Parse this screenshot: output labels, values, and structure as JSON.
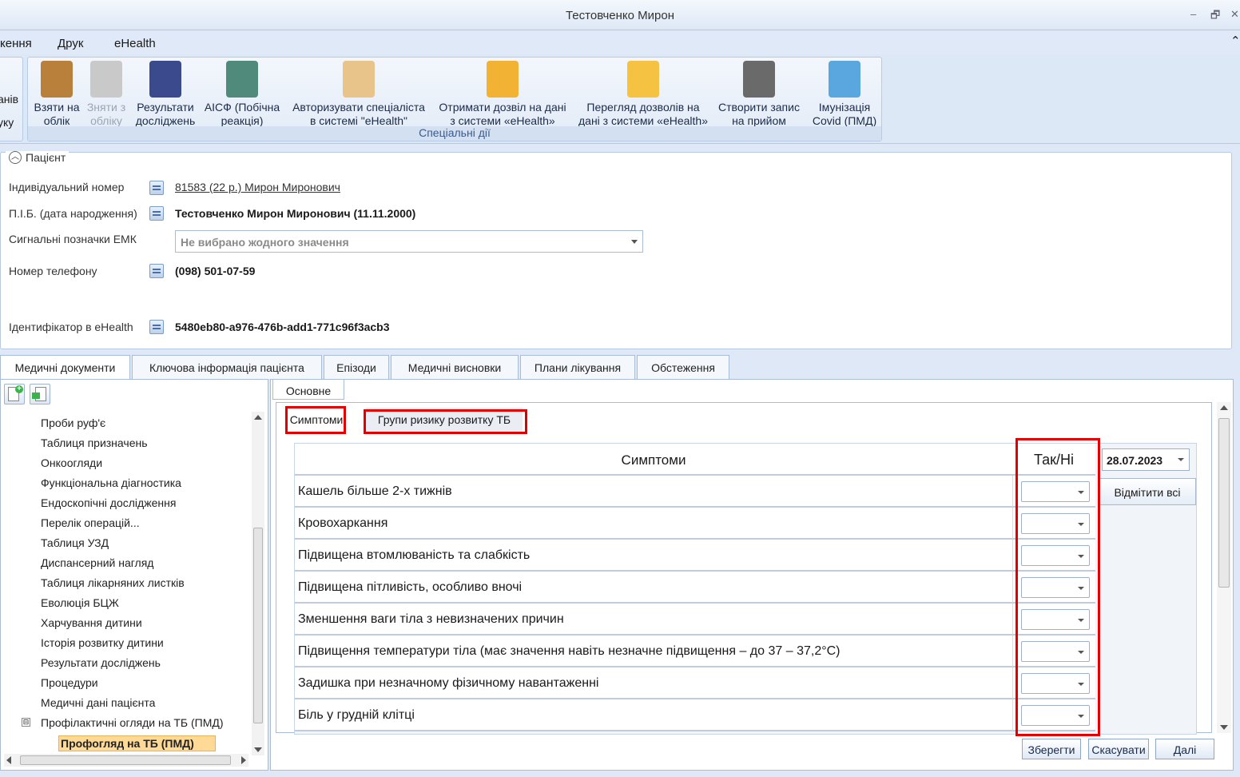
{
  "window": {
    "title": "Тестовченко Мирон",
    "min": "–",
    "restore": "🗗",
    "close": "✕"
  },
  "menu": {
    "items": [
      "кення",
      "Друк",
      "eHealth"
    ],
    "collapse": "⌃"
  },
  "ribbon": {
    "left_partial": [
      "анів",
      "уку"
    ],
    "group_caption": "Спеціальні дії",
    "buttons": [
      {
        "label1": "Взяти на",
        "label2": "облік",
        "icon": "book-add-icon",
        "color": "#b9803c",
        "disabled": false
      },
      {
        "label1": "Зняти з",
        "label2": "обліку",
        "icon": "book-remove-icon",
        "color": "#c9c9c9",
        "disabled": true
      },
      {
        "label1": "Результати",
        "label2": "досліджень",
        "icon": "lungs-icon",
        "color": "#3a4a8c",
        "disabled": false
      },
      {
        "label1": "АІСФ (Побічна",
        "label2": "реакція)",
        "icon": "emblem-icon",
        "color": "#4f8a7a",
        "disabled": false
      },
      {
        "label1": "Авторизувати спеціаліста",
        "label2": "в системі \"eHealth\"",
        "icon": "user-auth-icon",
        "color": "#e9c48a",
        "disabled": false
      },
      {
        "label1": "Отримати дозвіл на дані",
        "label2": "з системи «eHealth»",
        "icon": "folder-unlock-icon",
        "color": "#f2b233",
        "disabled": false
      },
      {
        "label1": "Перегляд дозволів на",
        "label2": "дані з системи «eHealth»",
        "icon": "folder-lock-icon",
        "color": "#f5c242",
        "disabled": false
      },
      {
        "label1": "Створити запис",
        "label2": "на прийом",
        "icon": "calendar-check-icon",
        "color": "#6a6a6a",
        "disabled": false
      },
      {
        "label1": "Імунізація",
        "label2": "Covid (ПМД)",
        "icon": "document-vaccine-icon",
        "color": "#5aa7e0",
        "disabled": false
      }
    ]
  },
  "patient": {
    "legend": "Пацієнт",
    "individual_number_label": "Індивідуальний номер",
    "individual_number_value": "81583 (22 р.) Мирон Миронович",
    "name_label": "П.І.Б. (дата народження)",
    "name_value": "Тестовченко Мирон Миронович (11.11.2000)",
    "signal_label": "Сигнальні позначки ЕМК",
    "signal_value": "Не вибрано жодного значення",
    "phone_label": "Номер телефону",
    "phone_value": "(098) 501-07-59",
    "ehealth_label": "Ідентифікатор в eHealth",
    "ehealth_value": "5480eb80-a976-476b-add1-771c96f3acb3"
  },
  "main_tabs": [
    "Медичні документи",
    "Ключова інформація пацієнта",
    "Епізоди",
    "Медичні висновки",
    "Плани лікування",
    "Обстеження"
  ],
  "tree": {
    "items": [
      "Проби руф'є",
      "Таблиця призначень",
      "Онкоогляди",
      "Функціональна діагностика",
      "Ендоскопічні дослідження",
      "Перелік операцій...",
      "Таблиця УЗД",
      "Диспансерний нагляд",
      "Таблиця лікарняних листків",
      "Еволюція БЦЖ",
      "Харчування дитини",
      "Історія розвитку дитини",
      "Результати досліджень",
      "Процедури",
      "Медичні дані пацієнта",
      "Профілактичні огляди на ТБ (ПМД)"
    ],
    "expander": "⊟",
    "selected": "Профогляд на ТБ (ПМД)"
  },
  "form": {
    "subtab": "Основне",
    "tabs": [
      "Симптоми",
      "Групи ризику розвитку ТБ"
    ],
    "col_symptoms": "Симптоми",
    "col_yesno": "Так/Ні",
    "date": "28.07.2023",
    "mark_all": "Відмітити всі",
    "rows": [
      "Кашель більше 2-х тижнів",
      "Кровохаркання",
      "Підвищена втомлюваність та слабкість",
      "Підвищена пітливість, особливо вночі",
      "Зменшення ваги тіла з невизначених причин",
      "Підвищення температури тіла (має значення навіть незначне підвищення – до 37 – 37,2°С)",
      "Задишка при незначному фізичному навантаженні",
      "Біль у грудній клітці"
    ],
    "save": "Зберегти",
    "cancel": "Скасувати",
    "next": "Далі"
  },
  "colors": {
    "accent": "#e00000",
    "selection": "#ffd996",
    "ribbon_bg": "#dde8f6"
  }
}
